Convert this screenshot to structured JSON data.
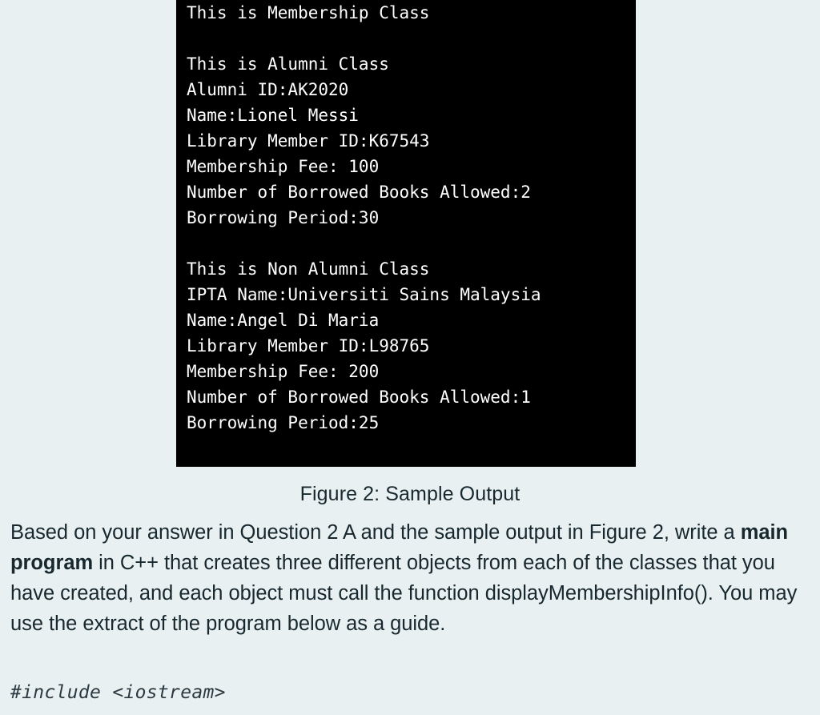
{
  "page": {
    "background_color": "#e9f0f2",
    "text_color": "#17282f"
  },
  "figure": {
    "caption": "Figure 2: Sample Output",
    "terminal": {
      "background_color": "#000000",
      "text_color": "#ffffff",
      "lines": [
        "This is Membership Class",
        "",
        "This is Alumni Class",
        "Alumni ID:AK2020",
        "Name:Lionel Messi",
        "Library Member ID:K67543",
        "Membership Fee: 100",
        "Number of Borrowed Books Allowed:2",
        "Borrowing Period:30",
        "",
        "This is Non Alumni Class",
        "IPTA Name:Universiti Sains Malaysia",
        "Name:Angel Di Maria",
        "Library Member ID:L98765",
        "Membership Fee: 200",
        "Number of Borrowed Books Allowed:1",
        "Borrowing Period:25"
      ]
    }
  },
  "question": {
    "text_before_bold": "Based on your answer in Question 2 A and the sample output in Figure 2, write a ",
    "bold_phrase": "main program",
    "text_after_bold": " in C++ that creates three different objects from each of the classes that you have created, and each object must call the function displayMembershipInfo().  You may use the extract of the program below as a guide.",
    "code_snippet": "#include <iostream>"
  }
}
